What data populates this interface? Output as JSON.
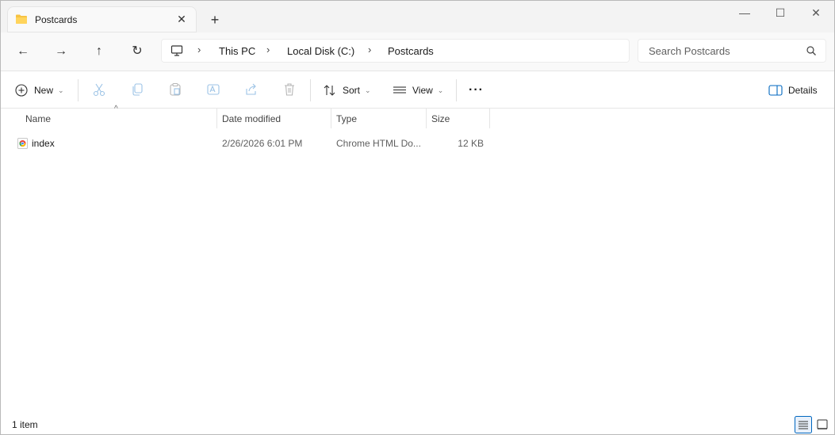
{
  "window": {
    "tab_title": "Postcards",
    "tab_close": "✕",
    "new_tab": "+",
    "minimize": "—",
    "maximize": "☐",
    "close": "✕"
  },
  "nav": {
    "back": "←",
    "forward": "→",
    "up": "↑",
    "refresh": "↻",
    "breadcrumb": [
      "This PC",
      "Local Disk (C:)",
      "Postcards"
    ],
    "search_placeholder": "Search Postcards"
  },
  "commands": {
    "new": "New",
    "sort": "Sort",
    "view": "View",
    "more": "···",
    "details": "Details"
  },
  "columns": [
    "Name",
    "Date modified",
    "Type",
    "Size"
  ],
  "files": [
    {
      "name": "index",
      "date": "2/26/2026 6:01 PM",
      "type": "Chrome HTML Do...",
      "size": "12 KB"
    }
  ],
  "status": "1 item",
  "colors": {
    "accent": "#0067c0",
    "folder": "#f7c342"
  }
}
